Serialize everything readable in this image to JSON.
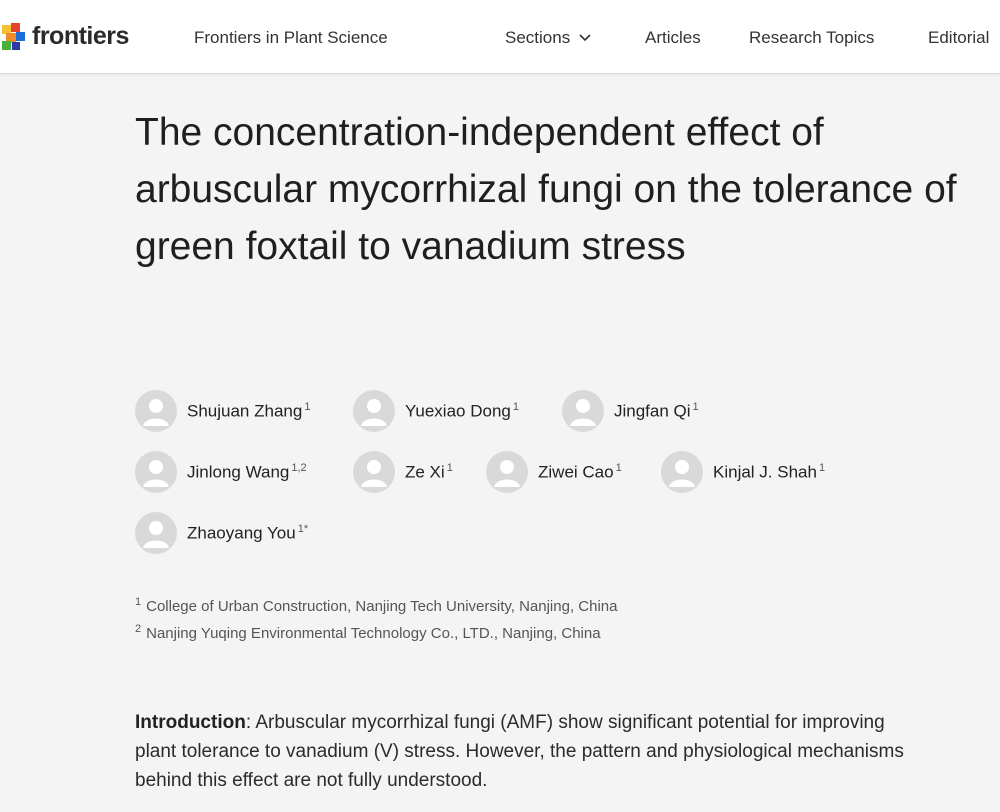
{
  "brand": {
    "name": "frontiers"
  },
  "nav": {
    "journal": "Frontiers in Plant Science",
    "sections": "Sections",
    "articles": "Articles",
    "research_topics": "Research Topics",
    "editorial": "Editorial"
  },
  "article": {
    "title": "The concentration-independent effect of arbuscular mycorrhizal fungi on the tolerance of green foxtail to vanadium stress",
    "authors": [
      {
        "name": "Shujuan Zhang",
        "sup": "1"
      },
      {
        "name": "Yuexiao Dong",
        "sup": "1"
      },
      {
        "name": "Jingfan Qi",
        "sup": "1"
      },
      {
        "name": "Jinlong Wang",
        "sup": "1,2"
      },
      {
        "name": "Ze Xi",
        "sup": "1"
      },
      {
        "name": "Ziwei Cao",
        "sup": "1"
      },
      {
        "name": "Kinjal J. Shah",
        "sup": "1"
      },
      {
        "name": "Zhaoyang You",
        "sup": "1*"
      }
    ],
    "affiliations": [
      {
        "sup": "1",
        "text": "College of Urban Construction, Nanjing Tech University, Nanjing, China"
      },
      {
        "sup": "2",
        "text": "Nanjing Yuqing Environmental Technology Co., LTD., Nanjing, China"
      }
    ],
    "abstract": {
      "label": "Introduction",
      "text": ": Arbuscular mycorrhizal fungi (AMF) show significant potential for improving plant tolerance to vanadium (V) stress. However, the pattern and physiological mechanisms behind this effect are not fully understood."
    }
  },
  "icons": {
    "sections_chevron": "chevron-down-icon",
    "avatar": "user-placeholder-icon",
    "logo": "frontiers-logo-mark"
  },
  "colors": {
    "background": "#f4f4f4",
    "topbar": "#ffffff",
    "avatar_bg": "#d9d9d9",
    "logo_orange": "#f28c28",
    "logo_red": "#e5412d",
    "logo_blue": "#1e6fd9",
    "logo_green": "#47b13a",
    "logo_yellow": "#f6c12f"
  }
}
